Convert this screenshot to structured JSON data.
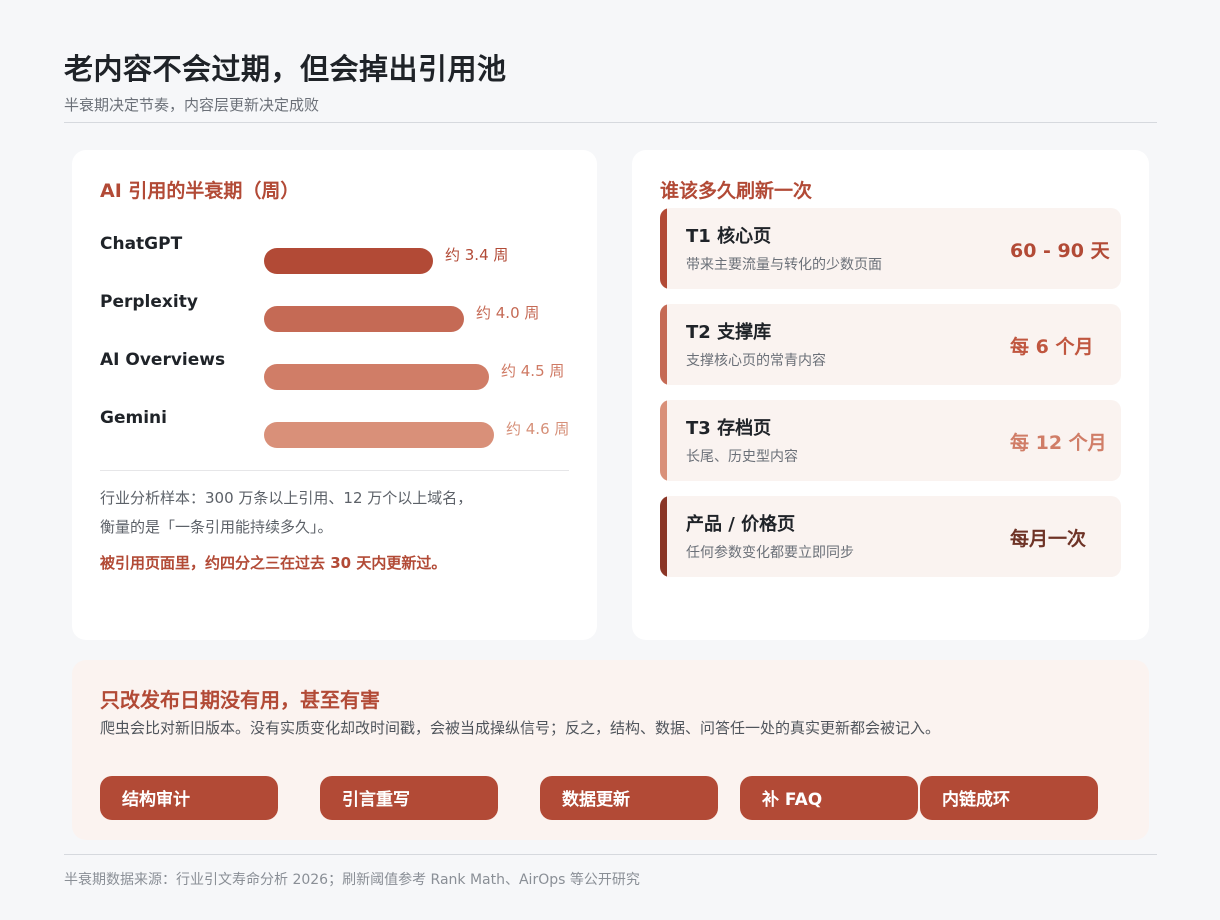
{
  "header": {
    "title": "老内容不会过期，但会掉出引用池",
    "subtitle": "半衰期决定节奏，内容层更新决定成败"
  },
  "half_life": {
    "title": "AI 引用的半衰期（周）",
    "chart_data": {
      "type": "bar",
      "categories": [
        "ChatGPT",
        "Perplexity",
        "AI Overviews",
        "Gemini"
      ],
      "values": [
        3.4,
        4.0,
        4.5,
        4.6
      ],
      "value_labels": [
        "约 3.4 周",
        "约 4.0 周",
        "约 4.5 周",
        "约 4.6 周"
      ],
      "colors": [
        "#b24a36",
        "#c56a55",
        "#d07d67",
        "#d99079"
      ],
      "label_colors": [
        "#b24a36",
        "#c56a55",
        "#cf7a64",
        "#d69079"
      ]
    },
    "note_line1": "行业分析样本：300 万条以上引用、12 万个以上域名，",
    "note_line2": "衡量的是「一条引用能持续多久」。",
    "emphasis": "被引用页面里，约四分之三在过去 30 天内更新过。"
  },
  "refresh": {
    "title": "谁该多久刷新一次",
    "tiers": [
      {
        "name": "T1 核心页",
        "desc": "带来主要流量与转化的少数页面",
        "freq": "60 - 90 天",
        "bar_color": "#b24a36",
        "freq_color": "#b24a36"
      },
      {
        "name": "T2 支撑库",
        "desc": "支撑核心页的常青内容",
        "freq": "每 6 个月",
        "bar_color": "#c56a55",
        "freq_color": "#c0563f"
      },
      {
        "name": "T3 存档页",
        "desc": "长尾、历史型内容",
        "freq": "每 12 个月",
        "bar_color": "#d99079",
        "freq_color": "#d07d67"
      },
      {
        "name": "产品 / 价格页",
        "desc": "任何参数变化都要立即同步",
        "freq": "每月一次",
        "bar_color": "#8a3526",
        "freq_color": "#6e3326"
      }
    ]
  },
  "warning": {
    "title": "只改发布日期没有用，甚至有害",
    "desc": "爬虫会比对新旧版本。没有实质变化却改时间戳，会被当成操纵信号；反之，结构、数据、问答任一处的真实更新都会被记入。",
    "actions": [
      "结构审计",
      "引言重写",
      "数据更新",
      "补 FAQ",
      "内链成环"
    ]
  },
  "footer": {
    "source": "半衰期数据来源：行业引文寿命分析 2026；刷新阈值参考 Rank Math、AirOps 等公开研究"
  }
}
